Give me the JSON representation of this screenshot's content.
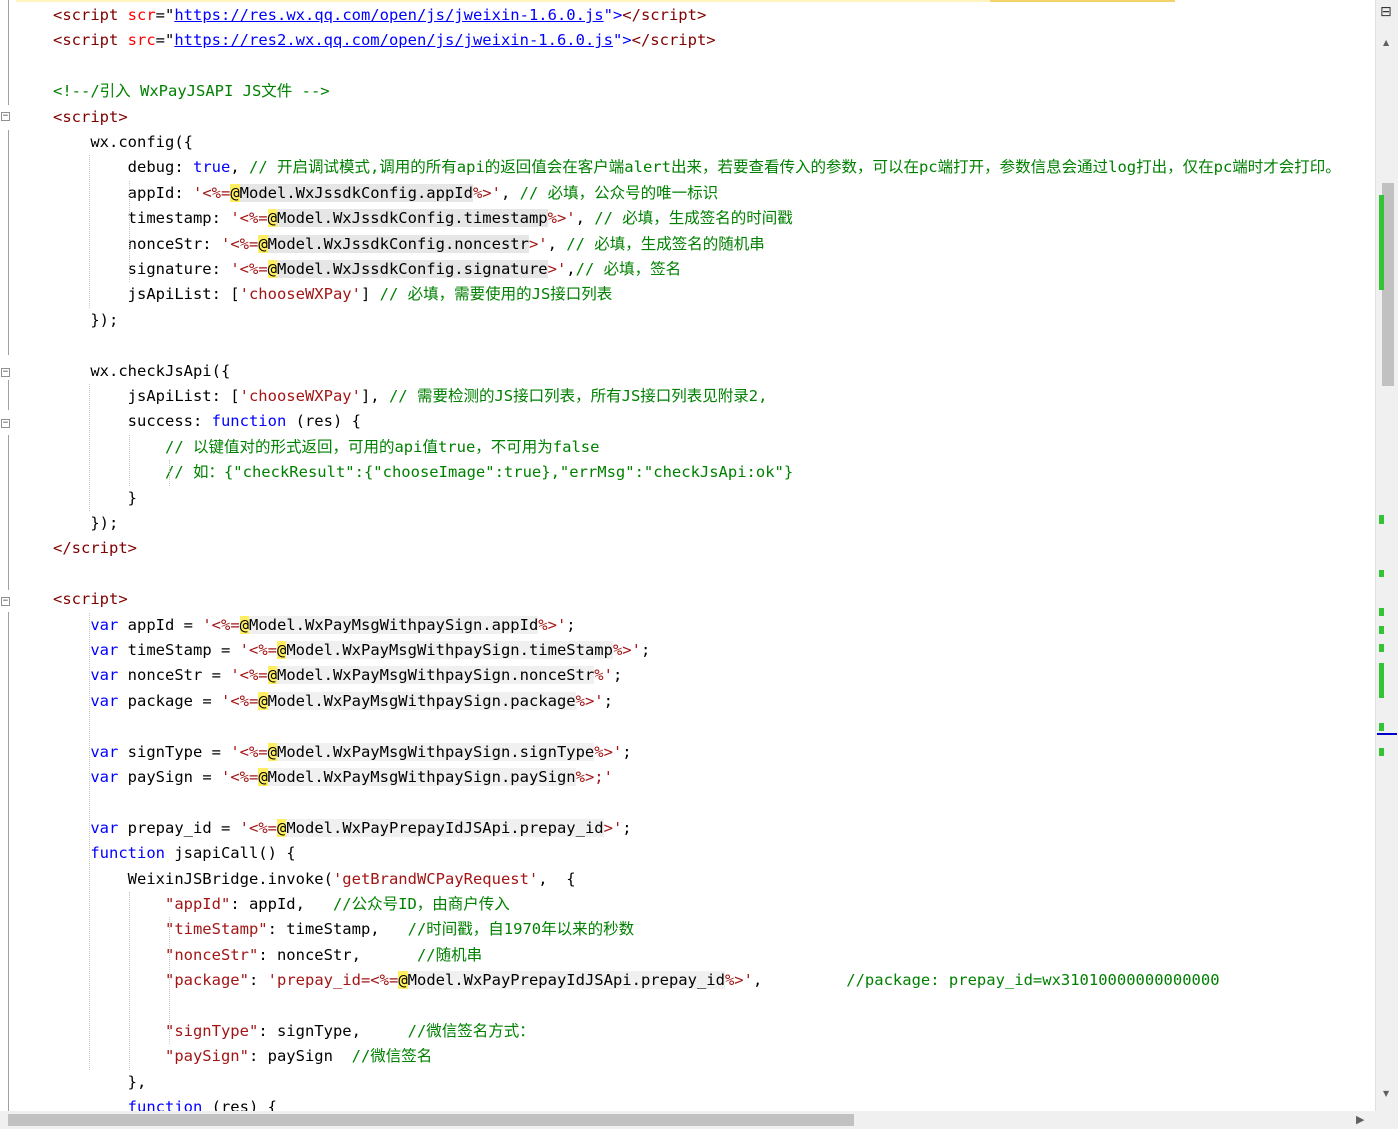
{
  "editor": {
    "lines": [
      [
        [
          "<",
          "c-tag"
        ],
        [
          "script ",
          "c-tag"
        ],
        [
          "scr",
          "c-attr"
        ],
        [
          "=\"",
          ""
        ],
        [
          "https://res.wx.qq.com/open/js/jweixin-1.6.0.js",
          "c-url"
        ],
        [
          "\">",
          "c-blue"
        ],
        [
          "</",
          "c-tag"
        ],
        [
          "script",
          "c-tag"
        ],
        [
          ">",
          "c-tag"
        ]
      ],
      [
        [
          "<",
          "c-tag"
        ],
        [
          "script ",
          "c-tag"
        ],
        [
          "src",
          "c-attr"
        ],
        [
          "=\"",
          ""
        ],
        [
          "https://res2.wx.qq.com/open/js/jweixin-1.6.0.js",
          "c-url"
        ],
        [
          "\">",
          "c-blue"
        ],
        [
          "</",
          "c-tag"
        ],
        [
          "script",
          "c-tag"
        ],
        [
          ">",
          "c-tag"
        ]
      ],
      [],
      [
        [
          "<!--/引入 WxPayJSAPI JS文件 -->",
          "c-com"
        ]
      ],
      [
        [
          "<",
          "c-tag"
        ],
        [
          "script",
          "c-tag"
        ],
        [
          ">",
          "c-tag"
        ]
      ],
      [
        [
          "    wx.config({",
          ""
        ]
      ],
      [
        [
          "        debug: ",
          ""
        ],
        [
          "true",
          "c-blue"
        ],
        [
          ", ",
          ""
        ],
        [
          "// 开启调试模式,调用的所有api的返回值会在客户端alert出来，若要查看传入的参数，可以在pc端打开，参数信息会通过log打出，仅在pc端时才会打印。",
          "c-com"
        ]
      ],
      [
        [
          "        appId: ",
          ""
        ],
        [
          "'<%=",
          "c-str"
        ],
        [
          "@",
          "c-at"
        ],
        [
          "Model.WxJssdkConfig.appId",
          "c-razor"
        ],
        [
          "%>'",
          "c-str"
        ],
        [
          ", ",
          ""
        ],
        [
          "// 必填，公众号的唯一标识",
          "c-com"
        ]
      ],
      [
        [
          "        timestamp: ",
          ""
        ],
        [
          "'<%=",
          "c-str"
        ],
        [
          "@",
          "c-at"
        ],
        [
          "Model.WxJssdkConfig.timestamp",
          "c-razor"
        ],
        [
          "%>'",
          "c-str"
        ],
        [
          ", ",
          ""
        ],
        [
          "// 必填，生成签名的时间戳",
          "c-com"
        ]
      ],
      [
        [
          "        nonceStr: ",
          ""
        ],
        [
          "'<%=",
          "c-str"
        ],
        [
          "@",
          "c-at"
        ],
        [
          "Model.WxJssdkConfig.noncestr",
          "c-razor"
        ],
        [
          ">'",
          "c-str"
        ],
        [
          ", ",
          ""
        ],
        [
          "// 必填，生成签名的随机串",
          "c-com"
        ]
      ],
      [
        [
          "        signature: ",
          ""
        ],
        [
          "'<%=",
          "c-str"
        ],
        [
          "@",
          "c-at"
        ],
        [
          "Model.WxJssdkConfig.signature",
          "c-razor"
        ],
        [
          ">'",
          "c-str"
        ],
        [
          ",",
          ""
        ],
        [
          "// 必填，签名",
          "c-com"
        ]
      ],
      [
        [
          "        jsApiList: [",
          ""
        ],
        [
          "'chooseWXPay'",
          "c-str"
        ],
        [
          "] ",
          ""
        ],
        [
          "// 必填，需要使用的JS接口列表",
          "c-com"
        ]
      ],
      [
        [
          "    });",
          ""
        ]
      ],
      [],
      [
        [
          "    wx.checkJsApi({",
          ""
        ]
      ],
      [
        [
          "        jsApiList: [",
          ""
        ],
        [
          "'chooseWXPay'",
          "c-str"
        ],
        [
          "], ",
          ""
        ],
        [
          "// 需要检测的JS接口列表，所有JS接口列表见附录2,",
          "c-com"
        ]
      ],
      [
        [
          "        success: ",
          ""
        ],
        [
          "function",
          "c-blue"
        ],
        [
          " (res) {",
          ""
        ]
      ],
      [
        [
          "            // 以键值对的形式返回，可用的api值true，不可用为false",
          "c-com"
        ]
      ],
      [
        [
          "            // 如：{\"checkResult\":{\"chooseImage\":true},\"errMsg\":\"checkJsApi:ok\"}",
          "c-com"
        ]
      ],
      [
        [
          "        }",
          ""
        ]
      ],
      [
        [
          "    });",
          ""
        ]
      ],
      [
        [
          "</",
          "c-tag"
        ],
        [
          "script",
          "c-tag"
        ],
        [
          ">",
          "c-tag"
        ]
      ],
      [],
      [
        [
          "<",
          "c-tag"
        ],
        [
          "script",
          "c-tag"
        ],
        [
          ">",
          "c-tag"
        ]
      ],
      [
        [
          "    ",
          ""
        ],
        [
          "var",
          "c-blue"
        ],
        [
          " appId = ",
          ""
        ],
        [
          "'<%=",
          "c-str"
        ],
        [
          "@",
          "c-at"
        ],
        [
          "Model.WxPayMsgWithpaySign.appId",
          "c-razor2"
        ],
        [
          "%>'",
          "c-str"
        ],
        [
          ";",
          ""
        ]
      ],
      [
        [
          "    ",
          ""
        ],
        [
          "var",
          "c-blue"
        ],
        [
          " timeStamp = ",
          ""
        ],
        [
          "'<%=",
          "c-str"
        ],
        [
          "@",
          "c-at"
        ],
        [
          "Model.WxPayMsgWithpaySign.timeStamp",
          "c-razor2"
        ],
        [
          "%>'",
          "c-str"
        ],
        [
          ";",
          ""
        ]
      ],
      [
        [
          "    ",
          ""
        ],
        [
          "var",
          "c-blue"
        ],
        [
          " nonceStr = ",
          ""
        ],
        [
          "'<%=",
          "c-str"
        ],
        [
          "@",
          "c-at"
        ],
        [
          "Model.WxPayMsgWithpaySign.nonceStr",
          "c-razor2"
        ],
        [
          "%'",
          "c-str"
        ],
        [
          ";",
          ""
        ]
      ],
      [
        [
          "    ",
          ""
        ],
        [
          "var",
          "c-blue"
        ],
        [
          " package = ",
          ""
        ],
        [
          "'<%=",
          "c-str"
        ],
        [
          "@",
          "c-at"
        ],
        [
          "Model.WxPayMsgWithpaySign.package",
          "c-razor2"
        ],
        [
          "%>'",
          "c-str"
        ],
        [
          ";",
          ""
        ]
      ],
      [],
      [
        [
          "    ",
          ""
        ],
        [
          "var",
          "c-blue"
        ],
        [
          " signType = ",
          ""
        ],
        [
          "'<%=",
          "c-str"
        ],
        [
          "@",
          "c-at"
        ],
        [
          "Model.WxPayMsgWithpaySign.signType",
          "c-razor2"
        ],
        [
          "%>'",
          "c-str"
        ],
        [
          ";",
          ""
        ]
      ],
      [
        [
          "    ",
          ""
        ],
        [
          "var",
          "c-blue"
        ],
        [
          " paySign = ",
          ""
        ],
        [
          "'<%=",
          "c-str"
        ],
        [
          "@",
          "c-at"
        ],
        [
          "Model.WxPayMsgWithpaySign.paySign",
          "c-razor2"
        ],
        [
          "%>;'",
          "c-str"
        ]
      ],
      [],
      [
        [
          "    ",
          ""
        ],
        [
          "var",
          "c-blue"
        ],
        [
          " prepay_id = ",
          ""
        ],
        [
          "'<%=",
          "c-str"
        ],
        [
          "@",
          "c-at"
        ],
        [
          "Model.WxPayPrepayIdJSApi.prepay_id",
          "c-razor2"
        ],
        [
          ">'",
          "c-str"
        ],
        [
          ";",
          ""
        ]
      ],
      [
        [
          "    ",
          ""
        ],
        [
          "function",
          "c-blue"
        ],
        [
          " jsapiCall() {",
          ""
        ]
      ],
      [
        [
          "        WeixinJSBridge.invoke(",
          ""
        ],
        [
          "'getBrandWCPayRequest'",
          "c-str"
        ],
        [
          ",  {",
          ""
        ]
      ],
      [
        [
          "            ",
          ""
        ],
        [
          "\"appId\"",
          "c-str"
        ],
        [
          ": appId,   ",
          ""
        ],
        [
          "//公众号ID，由商户传入",
          "c-com"
        ]
      ],
      [
        [
          "            ",
          ""
        ],
        [
          "\"timeStamp\"",
          "c-str"
        ],
        [
          ": timeStamp,   ",
          ""
        ],
        [
          "//时间戳，自1970年以来的秒数",
          "c-com"
        ]
      ],
      [
        [
          "            ",
          ""
        ],
        [
          "\"nonceStr\"",
          "c-str"
        ],
        [
          ": nonceStr,      ",
          ""
        ],
        [
          "//随机串",
          "c-com"
        ]
      ],
      [
        [
          "            ",
          ""
        ],
        [
          "\"package\"",
          "c-str"
        ],
        [
          ": ",
          ""
        ],
        [
          "'prepay_id=<%=",
          "c-str"
        ],
        [
          "@",
          "c-at"
        ],
        [
          "Model.WxPayPrepayIdJSApi.prepay_id",
          "c-razor2"
        ],
        [
          "%>'",
          "c-str"
        ],
        [
          ",         ",
          ""
        ],
        [
          "//package: prepay_id=wx31010000000000000",
          "c-com"
        ]
      ],
      [],
      [
        [
          "            ",
          ""
        ],
        [
          "\"signType\"",
          "c-str"
        ],
        [
          ": signType,     ",
          ""
        ],
        [
          "//微信签名方式：",
          "c-com"
        ]
      ],
      [
        [
          "            ",
          ""
        ],
        [
          "\"paySign\"",
          "c-str"
        ],
        [
          ": paySign  ",
          ""
        ],
        [
          "//微信签名",
          "c-com"
        ]
      ],
      [
        [
          "        },",
          ""
        ]
      ],
      [
        [
          "        ",
          ""
        ],
        [
          "function",
          "c-blue"
        ],
        [
          " (res) {",
          ""
        ]
      ]
    ]
  },
  "scrollbar": {
    "split_icon": "⊟",
    "up_arrow": "▲",
    "down_arrow": "▼",
    "right_arrow": "▶"
  }
}
